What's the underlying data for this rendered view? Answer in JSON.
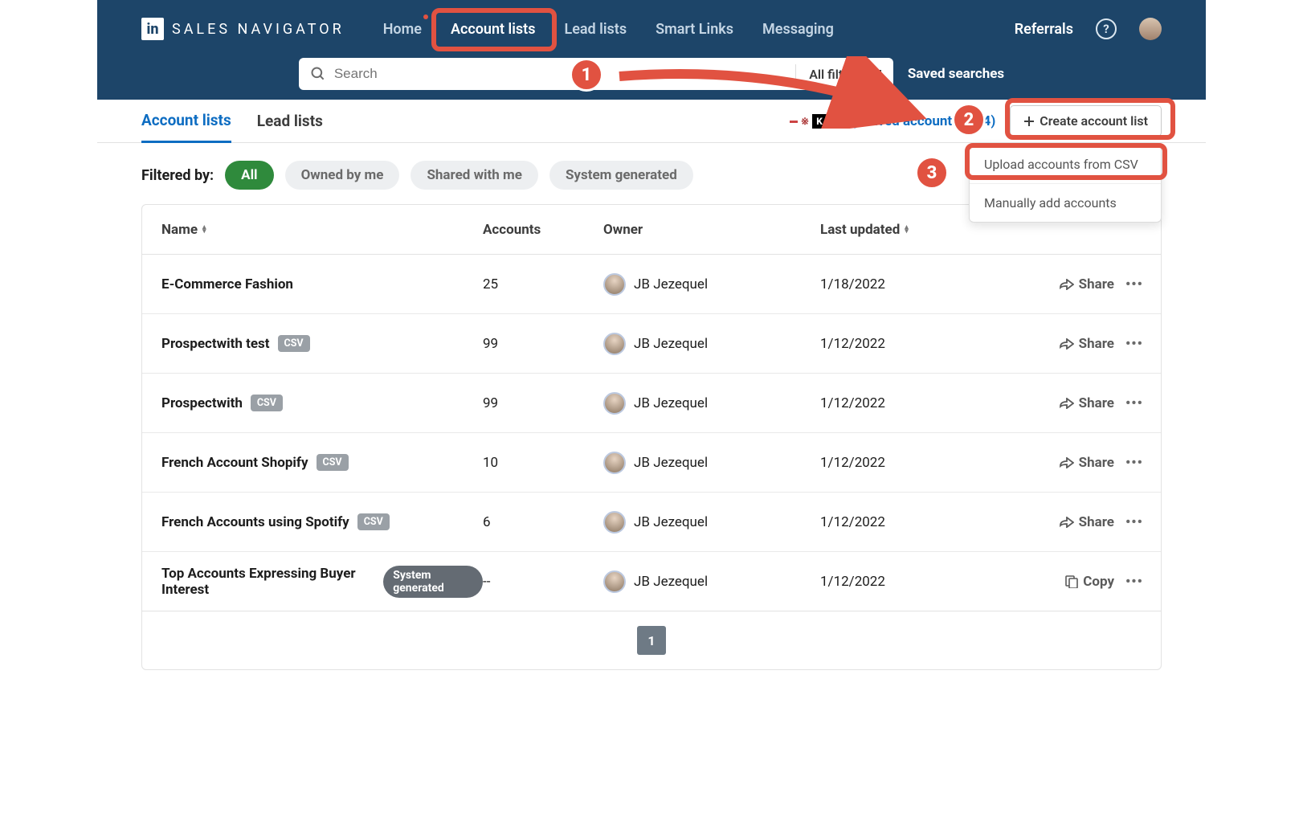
{
  "brand": {
    "logo_letters": "in",
    "logo_text": "SALES NAVIGATOR"
  },
  "nav": {
    "home": "Home",
    "account_lists": "Account lists",
    "lead_lists": "Lead lists",
    "smart_links": "Smart Links",
    "messaging": "Messaging",
    "referrals": "Referrals"
  },
  "search": {
    "placeholder": "Search",
    "all_filters": "All filters",
    "saved_searches": "Saved searches"
  },
  "subtabs": {
    "account_lists": "Account lists",
    "lead_lists": "Lead lists",
    "my_saved_accounts": "My saved accounts (684)",
    "create_btn": "Create account list"
  },
  "dropdown": {
    "upload_csv": "Upload accounts from CSV",
    "manual_add": "Manually add accounts"
  },
  "filter": {
    "label": "Filtered by:",
    "all": "All",
    "owned": "Owned by me",
    "shared": "Shared with me",
    "system": "System generated"
  },
  "columns": {
    "name": "Name",
    "accounts": "Accounts",
    "owner": "Owner",
    "last_updated": "Last updated"
  },
  "badges": {
    "csv": "CSV",
    "system": "System generated"
  },
  "rows": [
    {
      "name": "E-Commerce Fashion",
      "badge": null,
      "accounts": "25",
      "owner": "JB Jezequel",
      "updated": "1/18/2022",
      "action": "share"
    },
    {
      "name": "Prospectwith test",
      "badge": "csv",
      "accounts": "99",
      "owner": "JB Jezequel",
      "updated": "1/12/2022",
      "action": "share"
    },
    {
      "name": "Prospectwith",
      "badge": "csv",
      "accounts": "99",
      "owner": "JB Jezequel",
      "updated": "1/12/2022",
      "action": "share"
    },
    {
      "name": "French Account Shopify",
      "badge": "csv",
      "accounts": "10",
      "owner": "JB Jezequel",
      "updated": "1/12/2022",
      "action": "share"
    },
    {
      "name": "French Accounts using Spotify",
      "badge": "csv",
      "accounts": "6",
      "owner": "JB Jezequel",
      "updated": "1/12/2022",
      "action": "share"
    },
    {
      "name": "Top Accounts Expressing Buyer Interest",
      "badge": "system",
      "accounts": "--",
      "owner": "JB Jezequel",
      "updated": "1/12/2022",
      "action": "copy"
    }
  ],
  "actions": {
    "share": "Share",
    "copy": "Copy"
  },
  "pager": {
    "page": "1"
  },
  "annotations": {
    "step1": "1",
    "step2": "2",
    "step3": "3"
  }
}
